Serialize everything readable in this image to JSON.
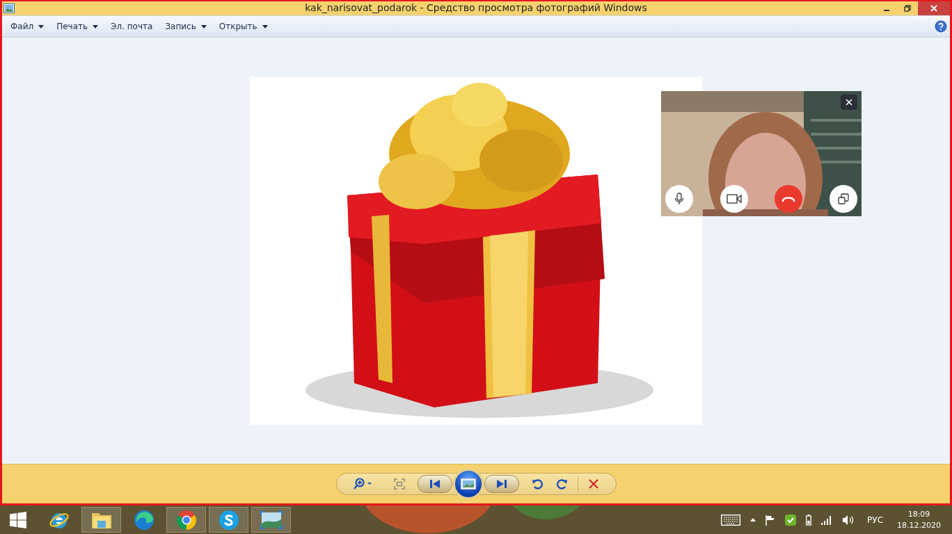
{
  "window": {
    "title": "kak_narisovat_podarok - Средство просмотра фотографий Windows"
  },
  "menu": [
    {
      "label": "Файл",
      "dropdown": true
    },
    {
      "label": "Печать",
      "dropdown": true
    },
    {
      "label": "Эл. почта",
      "dropdown": false
    },
    {
      "label": "Запись",
      "dropdown": true
    },
    {
      "label": "Открыть",
      "dropdown": true
    }
  ],
  "taskbar": {
    "apps": [
      {
        "kind": "ie",
        "open": false
      },
      {
        "kind": "files",
        "open": true
      },
      {
        "kind": "edge",
        "open": false
      },
      {
        "kind": "chrome",
        "open": true
      },
      {
        "kind": "skype",
        "open": true
      },
      {
        "kind": "photos",
        "open": true
      }
    ],
    "language": "РУС",
    "time": "18:09",
    "date": "18.12.2020"
  }
}
